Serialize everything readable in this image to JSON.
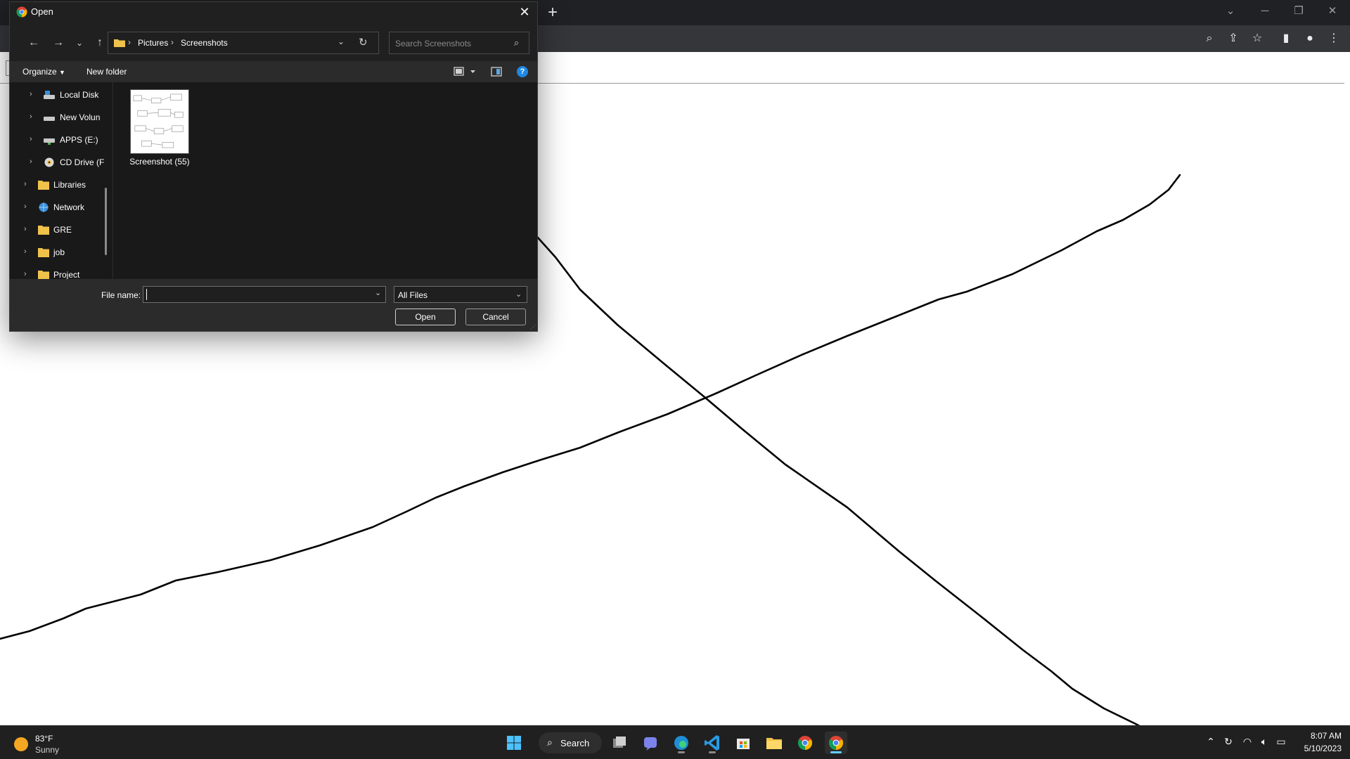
{
  "dialog": {
    "title": "Open",
    "breadcrumb": [
      "Pictures",
      "Screenshots"
    ],
    "search_placeholder": "Search Screenshots",
    "commands": {
      "organize": "Organize",
      "new_folder": "New folder"
    },
    "nav_items": [
      {
        "label": "Local Disk",
        "icon": "drive-icon"
      },
      {
        "label": "New Volun",
        "icon": "drive-icon"
      },
      {
        "label": "APPS (E:)",
        "icon": "network-drive-icon"
      },
      {
        "label": "CD Drive (F",
        "icon": "cd-drive-icon"
      },
      {
        "label": "Libraries",
        "icon": "folder-icon"
      },
      {
        "label": "Network",
        "icon": "network-icon"
      },
      {
        "label": "GRE",
        "icon": "folder-icon"
      },
      {
        "label": "job",
        "icon": "folder-icon"
      },
      {
        "label": "Project",
        "icon": "folder-icon"
      }
    ],
    "files": [
      {
        "name": "Screenshot (55)"
      }
    ],
    "file_name_label": "File name:",
    "file_name_value": "",
    "file_type": "All Files",
    "open_label": "Open",
    "cancel_label": "Cancel"
  },
  "browser": {
    "new_tab_symbol": "+"
  },
  "taskbar": {
    "weather": {
      "temp": "83°F",
      "condition": "Sunny"
    },
    "search_label": "Search",
    "apps": [
      "start-icon",
      "task-view-icon",
      "teams-chat-icon",
      "edge-icon",
      "vscode-icon",
      "store-icon",
      "file-explorer-icon",
      "chrome-icon",
      "chrome-icon"
    ],
    "clock": {
      "time": "8:07 AM",
      "date": "5/10/2023"
    }
  },
  "colors": {
    "accent": "#60cdff",
    "dialog_bg": "#2b2b2b",
    "pane_bg": "#191919",
    "titlebar_bg": "#202124"
  }
}
